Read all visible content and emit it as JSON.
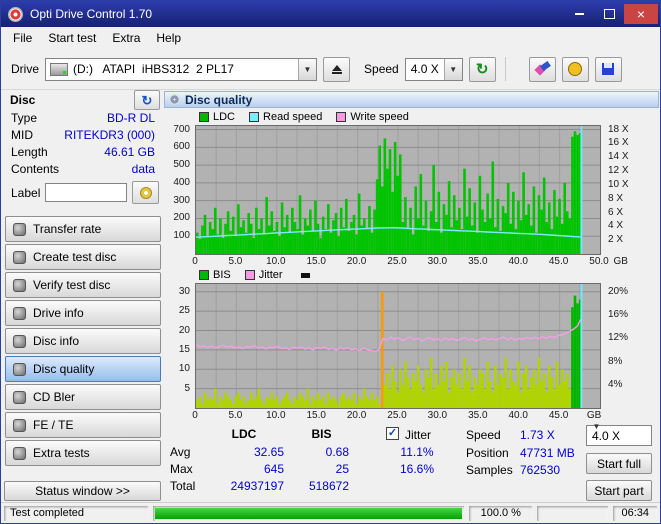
{
  "window": {
    "title": "Opti Drive Control 1.70"
  },
  "icons": {
    "dropdown_arrow": "▼",
    "check": "✓",
    "close": "×",
    "refresh": "↻"
  },
  "menu": {
    "items": [
      "File",
      "Start test",
      "Extra",
      "Help"
    ]
  },
  "toolbar": {
    "drive_label": "Drive",
    "drive_value": "(D:)   ATAPI  iHBS312  2 PL17",
    "speed_label": "Speed",
    "speed_value": "4.0 X"
  },
  "sidebar": {
    "disc_header": "Disc",
    "info": [
      {
        "label": "Type",
        "value": "BD-R DL"
      },
      {
        "label": "MID",
        "value": "RITEKDR3 (000)"
      },
      {
        "label": "Length",
        "value": "46.61 GB"
      },
      {
        "label": "Contents",
        "value": "data"
      }
    ],
    "label_field": {
      "label": "Label",
      "value": ""
    },
    "buttons": [
      {
        "label": "Transfer rate"
      },
      {
        "label": "Create test disc"
      },
      {
        "label": "Verify test disc"
      },
      {
        "label": "Drive info"
      },
      {
        "label": "Disc info"
      },
      {
        "label": "Disc quality"
      },
      {
        "label": "CD Bler"
      },
      {
        "label": "FE / TE"
      },
      {
        "label": "Extra tests"
      }
    ],
    "status_window": "Status window >>"
  },
  "main": {
    "header": "Disc quality",
    "legend_top": [
      {
        "label": "LDC",
        "color": "#00b800"
      },
      {
        "label": "Read speed",
        "color": "#7fe9ff"
      },
      {
        "label": "Write speed",
        "color": "#f49ae0"
      }
    ],
    "legend_bottom": [
      {
        "label": "BIS",
        "color": "#00b800"
      },
      {
        "label": "Jitter",
        "color": "#f49ae0"
      }
    ],
    "stats": {
      "col_ldc": "LDC",
      "col_bis": "BIS",
      "rows": [
        {
          "label": "Avg",
          "ldc": "32.65",
          "bis": "0.68",
          "jitter": "11.1%"
        },
        {
          "label": "Max",
          "ldc": "645",
          "bis": "25",
          "jitter": "16.6%"
        },
        {
          "label": "Total",
          "ldc": "24937197",
          "bis": "518672",
          "jitter": ""
        }
      ],
      "jitter_label": "Jitter",
      "speed_label": "Speed",
      "speed_value": "1.73 X",
      "position_label": "Position",
      "position_value": "47731 MB",
      "samples_label": "Samples",
      "samples_value": "762530",
      "speed_select": "4.0 X",
      "start_full": "Start full",
      "start_part": "Start part"
    }
  },
  "statusbar": {
    "status": "Test completed",
    "progress": 100,
    "percent": "100.0 %",
    "time": "06:34"
  },
  "chart_data": [
    {
      "name": "ldc-read-speed",
      "type": "bar+line",
      "title": "LDC errors (bars) with read speed (line)",
      "x_max": 50,
      "x_tick_step": 5,
      "x_grid_step": 2.5,
      "x_ticks": [
        "0",
        "5.0",
        "10.0",
        "15.0",
        "20.0",
        "25.0",
        "30.0",
        "35.0",
        "40.0",
        "45.0",
        "50.0"
      ],
      "x_unit": "GB",
      "unit_pos": 51.8,
      "y_max": 720,
      "y_ticks_left": [
        700,
        600,
        500,
        400,
        300,
        200,
        100
      ],
      "y_right_labels": [
        "18 X",
        "16 X",
        "14 X",
        "12 X",
        "10 X",
        "8 X",
        "6 X",
        "4 X",
        "2 X"
      ],
      "y_right_values": [
        700,
        622,
        544,
        467,
        389,
        311,
        233,
        156,
        78
      ],
      "data_end": 47.7,
      "cursor_x": 47.7,
      "cursor_color": "#70e8ff",
      "bar_color": "#00c400",
      "bars": [
        120,
        85,
        160,
        220,
        95,
        180,
        140,
        260,
        110,
        200,
        90,
        170,
        240,
        130,
        210,
        100,
        280,
        150,
        190,
        120,
        230,
        170,
        90,
        260,
        140,
        200,
        110,
        320,
        160,
        240,
        130,
        180,
        100,
        290,
        150,
        220,
        120,
        260,
        180,
        140,
        330,
        110,
        200,
        160,
        250,
        130,
        300,
        170,
        90,
        210,
        140,
        280,
        120,
        190,
        230,
        100,
        260,
        150,
        310,
        130,
        180,
        220,
        110,
        340,
        160,
        200,
        140,
        270,
        120,
        250,
        420,
        610,
        380,
        650,
        480,
        590,
        350,
        630,
        440,
        560,
        180,
        320,
        140,
        260,
        110,
        380,
        200,
        450,
        160,
        300,
        130,
        240,
        500,
        180,
        350,
        120,
        280,
        220,
        410,
        150,
        330,
        190,
        260,
        140,
        480,
        210,
        370,
        160,
        290,
        120,
        440,
        250,
        180,
        340,
        200,
        520,
        150,
        310,
        130,
        270,
        230,
        400,
        170,
        350,
        140,
        300,
        190,
        460,
        220,
        280,
        160,
        380,
        120,
        330,
        250,
        430,
        180,
        290,
        140,
        360,
        210,
        310,
        170,
        400,
        240,
        200,
        660,
        690,
        670,
        680
      ],
      "line_color": "#7fe9ff",
      "line": [
        95,
        97,
        99,
        101,
        104,
        106,
        108,
        111,
        113,
        115,
        118,
        120,
        122,
        125,
        127,
        129,
        131,
        134,
        136,
        138,
        140,
        142,
        144,
        146,
        147,
        148,
        146,
        144,
        142,
        140,
        138,
        136,
        134,
        132,
        130,
        128,
        126,
        124,
        122,
        120,
        118,
        116,
        114,
        112,
        110,
        107,
        104,
        101,
        98,
        95
      ]
    },
    {
      "name": "bis-jitter",
      "type": "bar+line",
      "title": "BIS errors (bars) with jitter (line)",
      "x_max": 50,
      "x_tick_step": 5,
      "x_grid_step": 2.5,
      "x_ticks": [
        "0",
        "5.0",
        "10.0",
        "15.0",
        "20.0",
        "25.0",
        "30.0",
        "35.0",
        "40.0",
        "45.0"
      ],
      "x_unit": "GB",
      "unit_pos": 48.5,
      "y_max": 32,
      "y_ticks_left": [
        30,
        25,
        20,
        15,
        10,
        5
      ],
      "y_right_labels": [
        "20%",
        "16%",
        "12%",
        "8%",
        "4%"
      ],
      "y_right_values": [
        30,
        24,
        18,
        12,
        6
      ],
      "data_end": 47.7,
      "cursor_x": 47.7,
      "cursor_color": "#70e8ff",
      "bar_color": "#b0d400",
      "special_bars": {
        "72": "#ff9900",
        "146": "#00b400",
        "147": "#00b400",
        "148": "#00b400",
        "149": "#00b400"
      },
      "bars": [
        2,
        3,
        1,
        4,
        2,
        3,
        2,
        5,
        1,
        3,
        2,
        4,
        3,
        2,
        1,
        3,
        4,
        2,
        3,
        1,
        2,
        4,
        2,
        3,
        5,
        2,
        1,
        3,
        2,
        4,
        2,
        3,
        1,
        2,
        3,
        4,
        2,
        1,
        3,
        2,
        4,
        3,
        2,
        5,
        1,
        3,
        2,
        4,
        2,
        3,
        1,
        4,
        2,
        3,
        2,
        1,
        3,
        4,
        2,
        3,
        2,
        4,
        1,
        3,
        2,
        5,
        3,
        2,
        4,
        2,
        3,
        1,
        30,
        6,
        9,
        5,
        11,
        7,
        4,
        10,
        6,
        12,
        8,
        5,
        9,
        7,
        11,
        6,
        4,
        10,
        8,
        13,
        5,
        9,
        6,
        11,
        7,
        12,
        4,
        8,
        10,
        6,
        9,
        5,
        13,
        7,
        11,
        4,
        8,
        6,
        10,
        9,
        5,
        12,
        7,
        4,
        11,
        6,
        9,
        8,
        13,
        5,
        10,
        7,
        6,
        12,
        4,
        9,
        11,
        5,
        8,
        10,
        6,
        13,
        7,
        9,
        4,
        11,
        8,
        5,
        12,
        6,
        10,
        7,
        9,
        5,
        26,
        29,
        27,
        28
      ],
      "line_color": "#f2a0e6",
      "line": [
        16.3,
        15.8,
        16.1,
        15.6,
        16.0,
        15.5,
        15.9,
        16.2,
        15.7,
        16.0,
        15.5,
        15.8,
        15.3,
        15.9,
        15.6,
        16.1,
        15.4,
        15.8,
        15.2,
        15.7,
        15.5,
        15.9,
        15.3,
        15.6,
        15.1,
        15.7,
        15.4,
        15.8,
        15.2,
        15.5,
        15.0,
        15.6,
        15.3,
        15.7,
        15.1,
        15.4,
        14.9,
        15.5,
        15.2,
        15.6,
        15.0,
        15.3,
        14.8,
        15.4,
        15.1,
        14.9,
        14.6,
        15.0,
        18.0,
        17.5,
        18.3,
        17.7,
        18.1,
        17.4,
        17.9,
        18.3,
        17.6,
        18.0,
        17.3,
        17.8,
        18.2,
        17.5,
        17.9,
        17.4,
        18.1,
        17.6,
        18.0,
        17.4,
        17.8,
        18.2,
        17.5,
        17.9,
        17.3,
        17.7,
        18.1,
        17.6,
        18.0,
        17.5,
        17.9,
        18.3,
        17.6,
        18.1,
        17.5,
        18.0,
        17.7,
        18.2,
        17.8,
        18.3,
        17.9,
        18.4,
        18.0,
        18.5,
        18.2,
        18.7,
        18.9,
        19.3,
        19.8,
        20.4,
        21.2,
        23.2
      ]
    }
  ]
}
